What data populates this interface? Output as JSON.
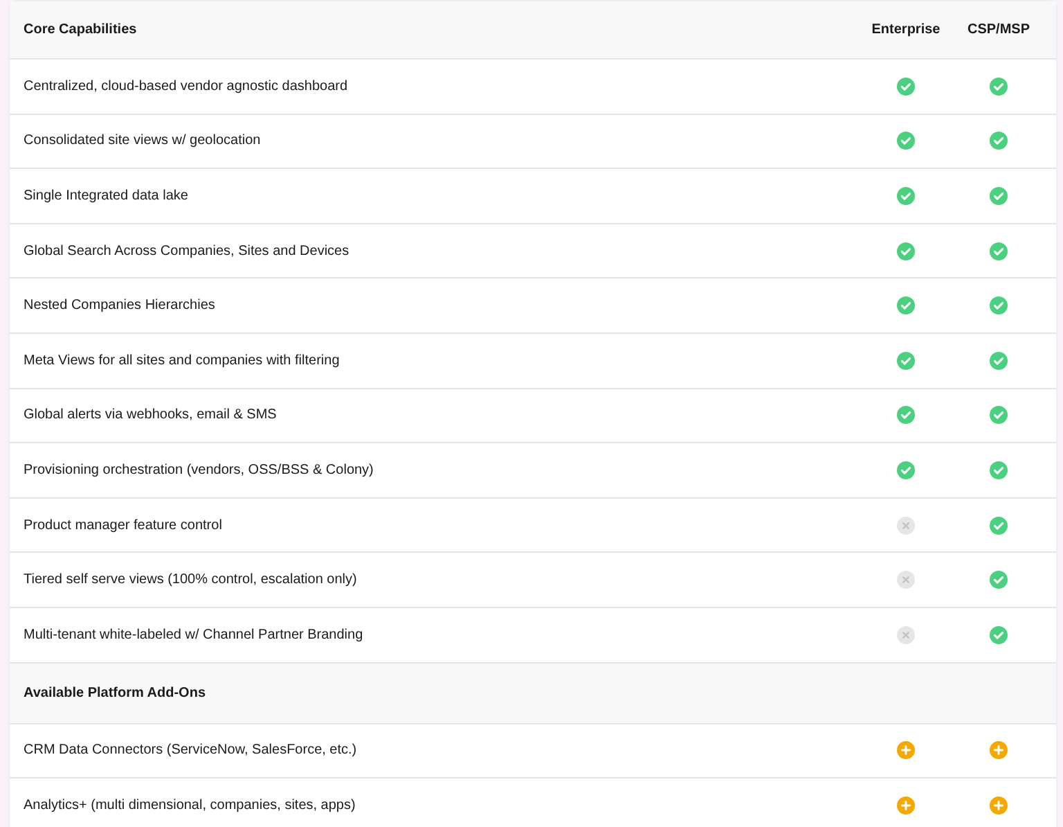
{
  "header": {
    "title": "Core Capabilities",
    "columns": [
      "Enterprise",
      "CSP/MSP"
    ]
  },
  "rows": [
    {
      "kind": "feature",
      "label": "Centralized, cloud-based vendor agnostic dashboard",
      "cells": [
        {
          "kind": "check"
        },
        {
          "kind": "check"
        }
      ]
    },
    {
      "kind": "feature",
      "label": "Consolidated site views w/ geolocation",
      "cells": [
        {
          "kind": "check"
        },
        {
          "kind": "check"
        }
      ]
    },
    {
      "kind": "feature",
      "label": "Single Integrated data lake",
      "cells": [
        {
          "kind": "check"
        },
        {
          "kind": "check"
        }
      ]
    },
    {
      "kind": "feature",
      "label": "Global Search Across Companies, Sites and Devices",
      "cells": [
        {
          "kind": "check"
        },
        {
          "kind": "check"
        }
      ]
    },
    {
      "kind": "feature",
      "label": "Nested Companies Hierarchies",
      "cells": [
        {
          "kind": "check"
        },
        {
          "kind": "check"
        }
      ]
    },
    {
      "kind": "feature",
      "label": "Meta Views for all sites and companies with filtering",
      "cells": [
        {
          "kind": "check"
        },
        {
          "kind": "check"
        }
      ]
    },
    {
      "kind": "feature",
      "label": "Global alerts via webhooks, email & SMS",
      "cells": [
        {
          "kind": "check"
        },
        {
          "kind": "check"
        }
      ]
    },
    {
      "kind": "feature",
      "label": "Provisioning orchestration (vendors, OSS/BSS & Colony)",
      "cells": [
        {
          "kind": "check"
        },
        {
          "kind": "check"
        }
      ]
    },
    {
      "kind": "feature",
      "label": "Product manager feature control",
      "cells": [
        {
          "kind": "cross"
        },
        {
          "kind": "check"
        }
      ]
    },
    {
      "kind": "feature",
      "label": "Tiered self serve views (100% control, escalation only)",
      "cells": [
        {
          "kind": "cross"
        },
        {
          "kind": "check"
        }
      ]
    },
    {
      "kind": "feature",
      "label": "Multi-tenant white-labeled w/ Channel Partner Branding",
      "cells": [
        {
          "kind": "cross"
        },
        {
          "kind": "check"
        }
      ]
    },
    {
      "kind": "section",
      "label": "Available Platform Add-Ons"
    },
    {
      "kind": "feature",
      "label": "CRM Data Connectors (ServiceNow, SalesForce, etc.)",
      "cells": [
        {
          "kind": "plus"
        },
        {
          "kind": "plus"
        }
      ]
    },
    {
      "kind": "feature",
      "label": "Analytics+ (multi dimensional, companies, sites, apps)",
      "cells": [
        {
          "kind": "plus"
        },
        {
          "kind": "plus"
        }
      ]
    }
  ]
}
